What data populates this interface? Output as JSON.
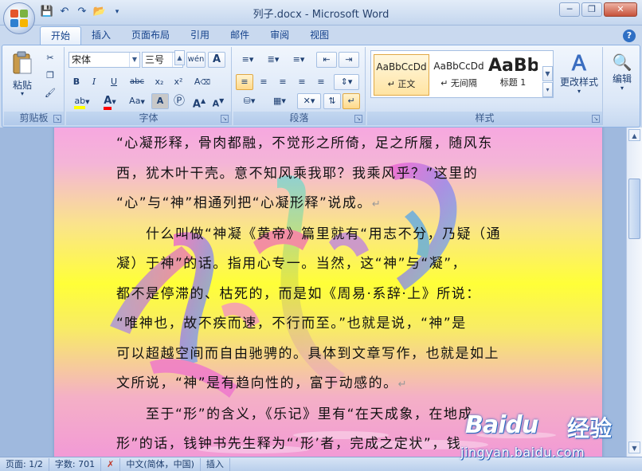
{
  "window": {
    "title": "列子.docx - Microsoft Word",
    "controls": [
      "minimize-icon",
      "restore-icon",
      "close-icon"
    ]
  },
  "quick_access": [
    "save-icon",
    "undo-icon",
    "redo-icon",
    "open-folder-icon",
    "customize-icon"
  ],
  "tabs": [
    {
      "label": "开始",
      "active": true
    },
    {
      "label": "插入"
    },
    {
      "label": "页面布局"
    },
    {
      "label": "引用"
    },
    {
      "label": "邮件"
    },
    {
      "label": "审阅"
    },
    {
      "label": "视图"
    }
  ],
  "ribbon": {
    "clipboard": {
      "label": "剪贴板",
      "paste": "粘贴"
    },
    "font": {
      "label": "字体",
      "font_name": "宋体",
      "font_size": "三号",
      "grow": "A",
      "shrink": "A",
      "bold": "B",
      "italic": "I",
      "underline": "U",
      "strike": "abc",
      "subscript": "x₂",
      "superscript": "x²",
      "change_case": "Aa",
      "char_shade": "A",
      "char_border": "A",
      "font_color_letter": "A",
      "highlight_letters": "ab",
      "phonetic": "wén",
      "clear_format": "A"
    },
    "paragraph": {
      "label": "段落"
    },
    "styles": {
      "label": "样式",
      "items": [
        {
          "preview": "AaBbCcDd",
          "name": "↵ 正文"
        },
        {
          "preview": "AaBbCcDd",
          "name": "↵ 无间隔"
        },
        {
          "preview": "AaBb",
          "name": "标题 1"
        }
      ],
      "change_styles": "更改样式"
    },
    "editing": {
      "label": "编辑"
    }
  },
  "document": {
    "lines": [
      "“心凝形释，骨肉都融，不觉形之所倚，足之所履，随风东",
      "西，犹木叶干壳。意不知风乘我耶？我乘风乎？”这里的",
      "“心”与“神”相通列把“心凝形释”说成。",
      "　　什么叫做“神凝《黄帝》篇里就有“用志不分，乃疑（通",
      "凝）于神”的话。指用心专一。当然，这“神”与“凝”，",
      "都不是停滞的、枯死的，而是如《周易·系辞·上》所说：",
      "“唯神也，故不疾而速，不行而至。”也就是说，“神”是",
      "可以超越空间而自由驰骋的。具体到文章写作，也就是如上",
      "文所说，“神”是有趋向性的，富于动感的。",
      "　　至于“形”的含义，《乐记》里有“在天成象，在地成",
      "形”的话，钱钟书先生释为“‘形’者，完成之定状”，钱"
    ],
    "paragraph_mark": "↵"
  },
  "status": {
    "page": "页面: 1/2",
    "words": "字数: 701",
    "language": "中文(简体，中国)",
    "mode": "插入"
  },
  "watermark": {
    "brand": "Baidu",
    "brand_suffix": "经验",
    "url": "jingyan.baidu.com"
  },
  "colors": {
    "ribbon_text": "#15428b",
    "font_color": "#ff0000",
    "highlight": "#ffff00",
    "style_selected": "#ffe4a3"
  }
}
